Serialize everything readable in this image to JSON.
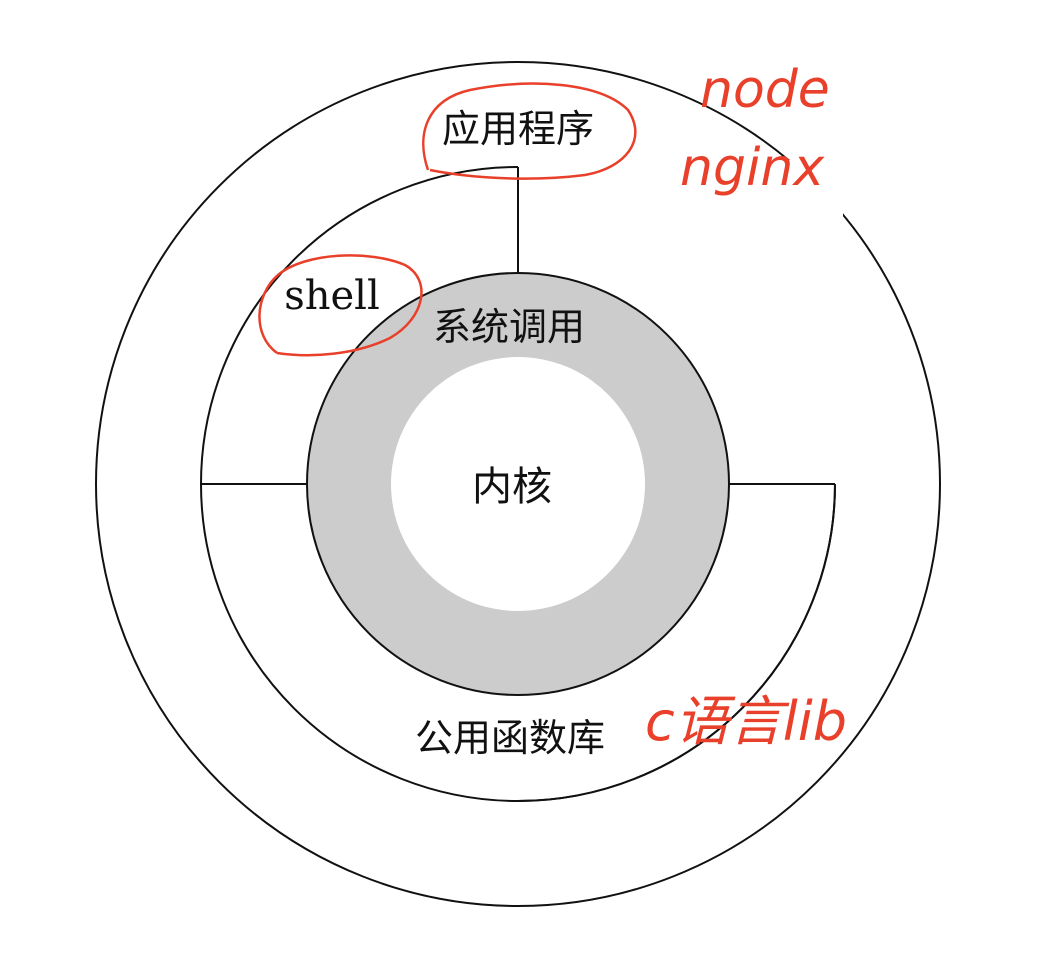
{
  "diagram": {
    "layers": {
      "kernel": "内核",
      "system_call": "系统调用",
      "shell": "shell",
      "library": "公用函数库",
      "application": "应用程序"
    },
    "annotations": {
      "app_examples_line1": "node",
      "app_examples_line2": "nginx",
      "library_note": "c语言lib"
    },
    "colors": {
      "line": "#111111",
      "syscall_ring": "#cccccc",
      "kernel_fill": "#ffffff",
      "annotation": "#e8402a"
    }
  }
}
